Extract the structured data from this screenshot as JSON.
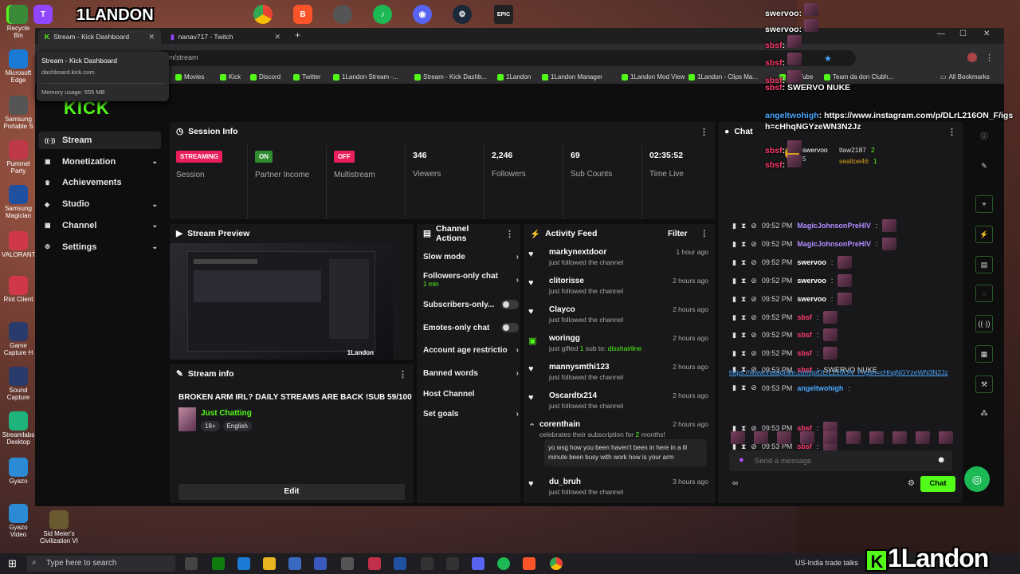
{
  "browser": {
    "tabs": [
      {
        "title": "Stream - Kick Dashboard",
        "active": true
      },
      {
        "title": "nanav717 - Twitch",
        "active": false
      }
    ],
    "url": "om/stream",
    "tooltip": {
      "title": "Stream - Kick Dashboard",
      "domain": "dashboard.kick.com",
      "memory": "Memory usage: 555 MB"
    },
    "bookmarks": [
      "Movies",
      "Kick",
      "Discord",
      "Twitter",
      "1Landon Stream -...",
      "Stream - Kick Dashb...",
      "1Landon",
      "1Landon Manager",
      "1Landon Mod View",
      "1Landon - Clips Ma...",
      "YouTube",
      "Team da don Clubh..."
    ],
    "all_bookmarks": "All Bookmarks"
  },
  "desktop_icons": [
    {
      "label": "Recycle Bin",
      "color": "#3a8a3a"
    },
    {
      "label": "Microsoft Edge",
      "color": "#1a7ad4"
    },
    {
      "label": "Samsung Portable S",
      "color": "#555"
    },
    {
      "label": "Pummel Party",
      "color": "#c0394a"
    },
    {
      "label": "Samsung Magician",
      "color": "#2050a0"
    },
    {
      "label": "VALORANT",
      "color": "#d0384a"
    },
    {
      "label": "Riot Client",
      "color": "#d0384a"
    },
    {
      "label": "Game Capture H",
      "color": "#2a3a6a"
    },
    {
      "label": "Sound Capture",
      "color": "#2a3a6a"
    },
    {
      "label": "Streamlabs Desktop",
      "color": "#1db37a"
    },
    {
      "label": "Gyazo",
      "color": "#2a8ad4"
    },
    {
      "label": "Gyazo Video",
      "color": "#2a8ad4"
    },
    {
      "label": "Sid Meier's Civilization VI",
      "color": "#6a5a30"
    }
  ],
  "sidebar": {
    "logo": "KICK",
    "items": [
      {
        "label": "Stream",
        "icon": "broadcast-icon",
        "expandable": false
      },
      {
        "label": "Monetization",
        "icon": "wallet-icon",
        "expandable": true
      },
      {
        "label": "Achievements",
        "icon": "trophy-icon",
        "expandable": false
      },
      {
        "label": "Studio",
        "icon": "studio-icon",
        "expandable": true
      },
      {
        "label": "Channel",
        "icon": "channel-icon",
        "expandable": true
      },
      {
        "label": "Settings",
        "icon": "gear-icon",
        "expandable": true
      }
    ]
  },
  "session": {
    "title": "Session Info",
    "stats": [
      {
        "badge": "STREAMING",
        "badge_color": "#e91e5a",
        "label": "Session"
      },
      {
        "badge": "ON",
        "badge_color": "#2e8b2e",
        "label": "Partner Income"
      },
      {
        "badge": "OFF",
        "badge_color": "#e91e5a",
        "label": "Multistream"
      },
      {
        "value": "346",
        "label": "Viewers"
      },
      {
        "value": "2,246",
        "label": "Followers"
      },
      {
        "value": "69",
        "label": "Sub Counts"
      },
      {
        "value": "02:35:52",
        "label": "Time Live"
      }
    ]
  },
  "preview": {
    "title": "Stream Preview",
    "watermark": "1Landon"
  },
  "stream_info": {
    "title": "Stream info",
    "stream_title": "BROKEN ARM IRL? DAILY STREAMS ARE BACK !SUB 59/100",
    "category": "Just Chatting",
    "tags": [
      "18+",
      "English"
    ],
    "edit": "Edit"
  },
  "channel_actions": {
    "title": "Channel Actions",
    "items": [
      {
        "label": "Slow mode",
        "kind": "arrow"
      },
      {
        "label": "Followers-only chat",
        "sub": "1 min",
        "kind": "arrow"
      },
      {
        "label": "Subscribers-only...",
        "kind": "toggle"
      },
      {
        "label": "Emotes-only chat",
        "kind": "toggle"
      },
      {
        "label": "Account age restriction",
        "kind": "arrow"
      },
      {
        "label": "Banned words",
        "kind": "arrow"
      },
      {
        "label": "Host Channel",
        "kind": "none"
      },
      {
        "label": "Set goals",
        "kind": "arrow"
      }
    ]
  },
  "activity": {
    "title": "Activity Feed",
    "filter": "Filter",
    "items": [
      {
        "name": "markynextdoor",
        "sub": "just followed the channel",
        "time": "1 hour ago",
        "icon": "heart-icon"
      },
      {
        "name": "clitorisse",
        "sub": "just followed the channel",
        "time": "2 hours ago",
        "icon": "heart-icon"
      },
      {
        "name": "Clayco",
        "sub": "just followed the channel",
        "time": "2 hours ago",
        "icon": "heart-icon"
      },
      {
        "name": "woringg",
        "sub_pre": "just gifted ",
        "sub_hl": "1",
        "sub_mid": " sub to: ",
        "sub_hl2": "disshairline",
        "time": "2 hours ago",
        "icon": "gift-icon"
      },
      {
        "name": "mannysmthi123",
        "sub": "just followed the channel",
        "time": "2 hours ago",
        "icon": "heart-icon"
      },
      {
        "name": "Oscardtx214",
        "sub": "just followed the channel",
        "time": "2 hours ago",
        "icon": "heart-icon"
      },
      {
        "name": "corenthain",
        "sub_pre": "celebrates their subscription for ",
        "sub_hl": "2",
        "sub_mid": " months!",
        "time": "2 hours ago",
        "icon": "star-icon",
        "quote": "yo wsg how you been haven't been in here in a lil minute been busy with work how is your arm"
      },
      {
        "name": "du_bruh",
        "sub": "just followed the channel",
        "time": "3 hours ago",
        "icon": "heart-icon"
      }
    ]
  },
  "chat": {
    "title": "Chat",
    "pinned_user": "swervoo",
    "pinned_count": "5",
    "top_users": [
      {
        "name": "tlaw2187",
        "count": "2"
      },
      {
        "name": "sealtoe46",
        "count": "1"
      }
    ],
    "messages": [
      {
        "time": "09:52 PM",
        "user": "MagicJohnsonPreHIV",
        "color": "#b28cff",
        "text": ""
      },
      {
        "time": "09:52 PM",
        "user": "MagicJohnsonPreHIV",
        "color": "#b28cff",
        "text": ""
      },
      {
        "time": "09:52 PM",
        "user": "swervoo",
        "color": "#ffffff",
        "text": ""
      },
      {
        "time": "09:52 PM",
        "user": "swervoo",
        "color": "#ffffff",
        "text": ""
      },
      {
        "time": "09:52 PM",
        "user": "swervoo",
        "color": "#ffffff",
        "text": ""
      },
      {
        "time": "09:52 PM",
        "user": "sbsf",
        "color": "#ff3b6e",
        "text": ""
      },
      {
        "time": "09:52 PM",
        "user": "sbsf",
        "color": "#ff3b6e",
        "text": ""
      },
      {
        "time": "09:52 PM",
        "user": "sbsf",
        "color": "#ff3b6e",
        "text": ""
      },
      {
        "time": "09:53 PM",
        "user": "sbsf",
        "color": "#ff3b6e",
        "text": "SWERVO NUKE"
      },
      {
        "time": "09:53 PM",
        "user": "angeltwohigh",
        "color": "#4aa8ff",
        "text": ""
      },
      {
        "time": "09:53 PM",
        "user": "sbsf",
        "color": "#ff3b6e",
        "text": ""
      },
      {
        "time": "09:53 PM",
        "user": "sbsf",
        "color": "#ff3b6e",
        "text": ""
      }
    ],
    "link_text": "https://www.instagram.com/p/DLrL216ON_F/igsh=cHhqNGYzeWN3N2Jz",
    "placeholder": "Send a message",
    "send": "Chat"
  },
  "overlay_chat": [
    {
      "user": "swervoo",
      "color": "#ffffff",
      "text": ""
    },
    {
      "user": "swervoo",
      "color": "#ffffff",
      "text": ""
    },
    {
      "user": "sbsf",
      "color": "#ff3b6e",
      "text": ""
    },
    {
      "user": "sbsf",
      "color": "#ff3b6e",
      "text": ""
    },
    {
      "user": "sbsf",
      "color": "#ff3b6e",
      "text": ""
    },
    {
      "user": "sbsf",
      "color": "#ff3b6e",
      "text": "SWERVO NUKE"
    },
    {
      "user": "angeltwohigh",
      "color": "#4aa8ff",
      "text": "https://www.instagram.com/p/DLrL216ON_F/igsh=cHhqNGYzeWN3N2Jz"
    },
    {
      "user": "sbsf",
      "color": "#ff3b6e",
      "text": ""
    },
    {
      "user": "sbsf",
      "color": "#ff3b6e",
      "text": ""
    }
  ],
  "taskbar": {
    "search": "Type here to search",
    "news": "US-India trade talks"
  },
  "branding": {
    "watermark": "1Landon",
    "top_logo": "1LANDON"
  }
}
